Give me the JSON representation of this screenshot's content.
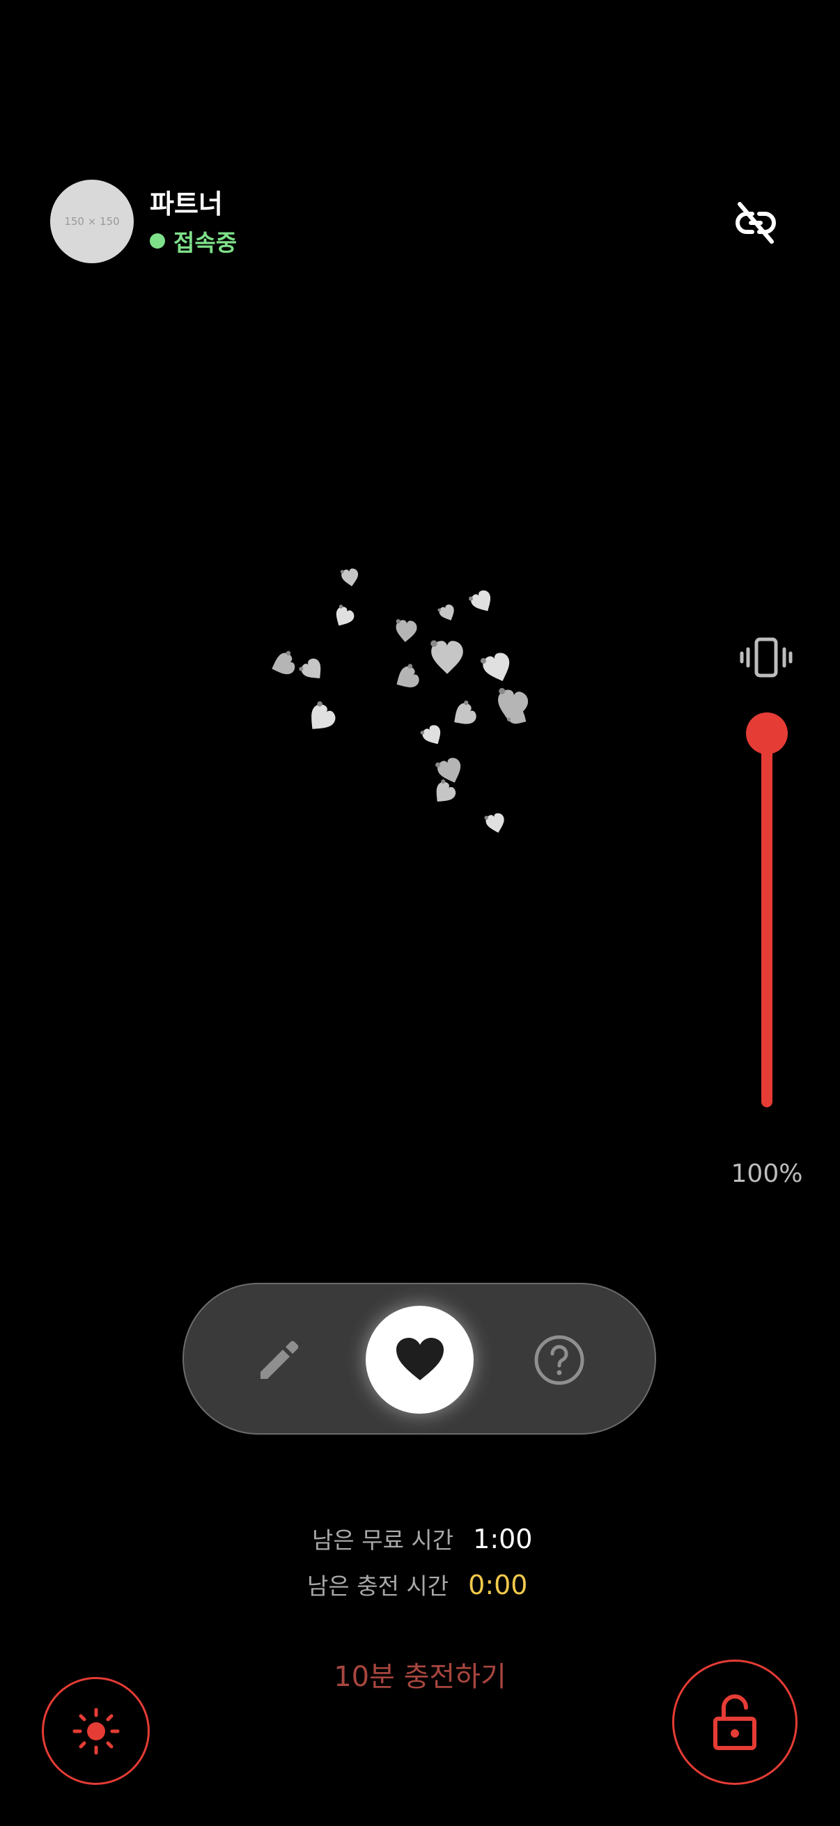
{
  "partner": {
    "avatar_placeholder": "150 × 150",
    "name": "파트너",
    "status": "접속중",
    "status_color": "#7fe08a"
  },
  "icons": {
    "unlink": "unlink-icon",
    "vibrate": "vibrate-icon",
    "pencil": "pencil-icon",
    "heart": "heart-icon",
    "help": "help-icon",
    "brightness": "sun-icon",
    "lock": "unlock-icon"
  },
  "intensity": {
    "value_percent": 100,
    "label": "100%",
    "accent_color": "#e53c35"
  },
  "modes": {
    "items": [
      "draw",
      "heart",
      "help"
    ],
    "selected": "heart"
  },
  "timers": {
    "free_label": "남은 무료 시간",
    "free_value": "1:00",
    "charge_label": "남은 충전 시간",
    "charge_value": "0:00",
    "charge_value_color": "#f2c94c"
  },
  "charge_action": "10분 충전하기",
  "colors": {
    "background": "#000000",
    "accent": "#e53c35",
    "hearts": "#d9d9d9"
  }
}
